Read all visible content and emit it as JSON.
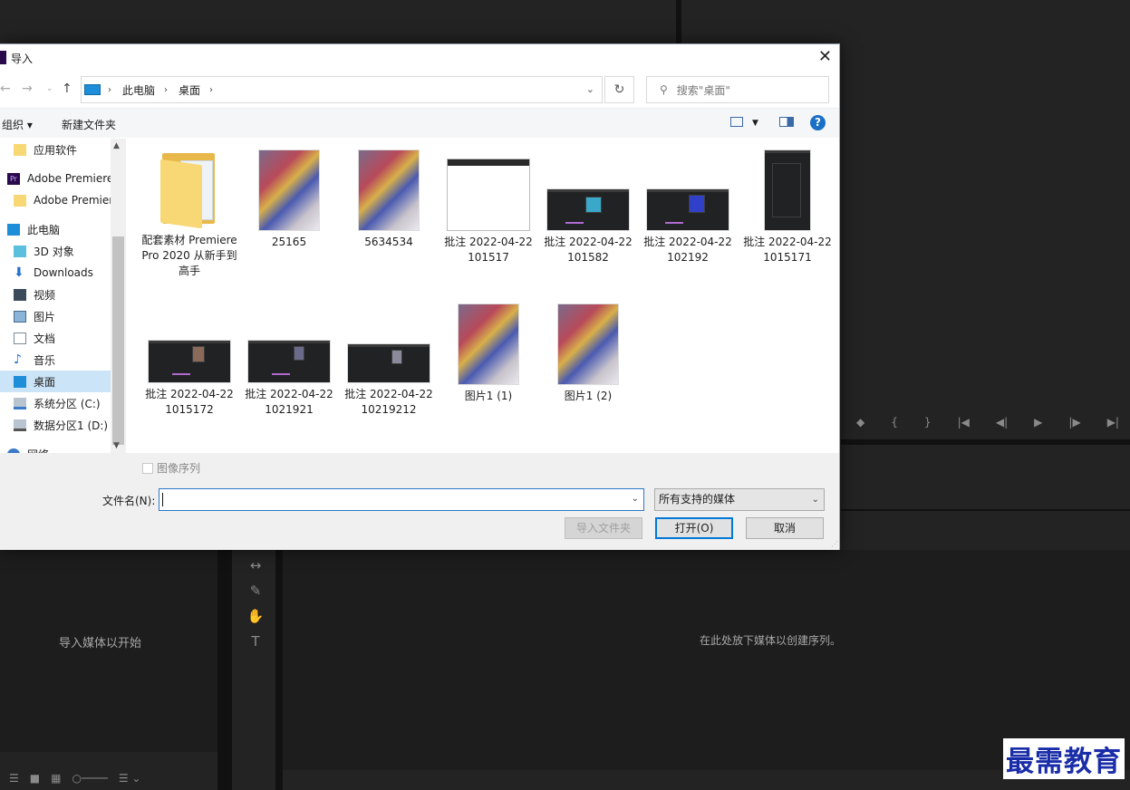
{
  "background": {
    "import_hint": "导入媒体以开始",
    "drop_hint": "在此处放下媒体以创建序列。"
  },
  "watermark": "最需教育",
  "dialog": {
    "title": "导入",
    "address": {
      "crumbs": [
        "此电脑",
        "桌面"
      ]
    },
    "search_placeholder": "搜索\"桌面\"",
    "toolbar": {
      "organize": "组织 ▾",
      "new_folder": "新建文件夹"
    },
    "nav": [
      {
        "label": "应用软件",
        "icon": "folder-icon"
      },
      {
        "label": "Adobe Premiere",
        "icon": "premiere-icon"
      },
      {
        "label": "Adobe Premier",
        "icon": "folder-icon"
      },
      {
        "label": "此电脑",
        "icon": "computer-icon"
      },
      {
        "label": "3D 对象",
        "icon": "cube-icon"
      },
      {
        "label": "Downloads",
        "icon": "download-icon"
      },
      {
        "label": "视频",
        "icon": "video-icon"
      },
      {
        "label": "图片",
        "icon": "picture-icon"
      },
      {
        "label": "文档",
        "icon": "document-icon"
      },
      {
        "label": "音乐",
        "icon": "music-icon"
      },
      {
        "label": "桌面",
        "icon": "desktop-icon",
        "selected": true
      },
      {
        "label": "系统分区 (C:)",
        "icon": "drive-icon"
      },
      {
        "label": "数据分区1 (D:)",
        "icon": "drive-icon"
      },
      {
        "label": "网络",
        "icon": "network-icon"
      }
    ],
    "files": [
      {
        "label": "配套素材 Premiere Pro 2020 从新手到高手",
        "type": "folder"
      },
      {
        "label": "25165",
        "type": "photo"
      },
      {
        "label": "5634534",
        "type": "photo"
      },
      {
        "label": "批注 2022-04-22 101517",
        "type": "white"
      },
      {
        "label": "批注 2022-04-22 101582",
        "type": "dark"
      },
      {
        "label": "批注 2022-04-22 102192",
        "type": "dark"
      },
      {
        "label": "批注 2022-04-22 1015171",
        "type": "tall"
      },
      {
        "label": "批注 2022-04-22 1015172",
        "type": "dark"
      },
      {
        "label": "批注 2022-04-22 1021921",
        "type": "dark"
      },
      {
        "label": "批注 2022-04-22 10219212",
        "type": "dark"
      },
      {
        "label": "图片1 (1)",
        "type": "photo"
      },
      {
        "label": "图片1 (2)",
        "type": "photo"
      }
    ],
    "image_sequence": "图像序列",
    "filename_label": "文件名(N):",
    "filename_value": "",
    "filetype": "所有支持的媒体",
    "buttons": {
      "import_folder": "导入文件夹",
      "open": "打开(O)",
      "cancel": "取消"
    }
  }
}
